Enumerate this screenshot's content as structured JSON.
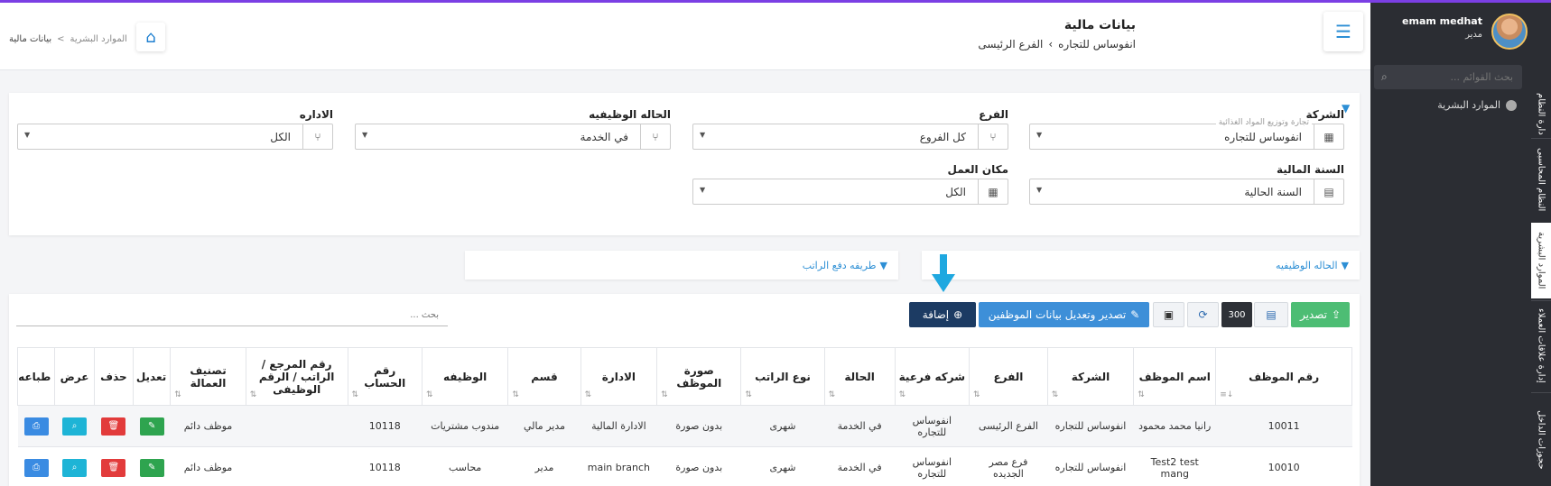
{
  "header": {
    "title": "بيانات مالية",
    "crumb_company": "انفوساس للتجاره",
    "crumb_branch": "الفرع الرئيسى",
    "left_crumb": [
      "بيانات مالية",
      "الموارد البشرية"
    ]
  },
  "user": {
    "name": "emam medhat",
    "role": "مدير"
  },
  "sidebar": {
    "search_placeholder": "بحث القوائم ...",
    "active_menu_item": "الموارد البشرية",
    "vertical_tabs": [
      "دارة النظام",
      "النظام المحاسبى",
      "الموارد البشرية",
      "إدارة علاقات العملاء",
      "حجوزات الداخل"
    ]
  },
  "filters": {
    "company": {
      "label": "الشركة",
      "hint": "تجارة وتوزيع المواد الغذائية",
      "value": "انفوساس للتجاره"
    },
    "branch": {
      "label": "الفرع",
      "value": "كل الفروع"
    },
    "job_status": {
      "label": "الحاله الوظيفيه",
      "value": "في الخدمة"
    },
    "department": {
      "label": "الاداره",
      "value": "الكل"
    },
    "fiscal_year": {
      "label": "السنة المالية",
      "value": "السنة الحالية"
    },
    "workplace": {
      "label": "مكان العمل",
      "value": "الكل"
    }
  },
  "subfilters": {
    "job_status": "الحاله الوظيفيه",
    "salary_payment": "طريقه دفع الراتب"
  },
  "toolbar": {
    "export": "تصدير",
    "page_size": "300",
    "export_edit_employees": "تصدير وتعديل بيانات الموظفين",
    "add": "إضافة",
    "search_placeholder": "بحث ..."
  },
  "table": {
    "columns": [
      "رقم الموظف",
      "اسم الموظف",
      "الشركة",
      "الفرع",
      "شركه فرعية",
      "الحالة",
      "نوع الراتب",
      "صورة الموظف",
      "الادارة",
      "قسم",
      "الوظيفه",
      "رقم الحساب",
      "رقم المرجع / الراتب / الرقم الوظيفى",
      "تصنيف العمالة",
      "تعديل",
      "حذف",
      "عرض",
      "طباعه"
    ],
    "rows": [
      [
        "10011",
        "رانيا محمد محمود",
        "انفوساس للتجاره",
        "الفرع الرئيسى",
        "انفوساس للتجاره",
        "في الخدمة",
        "شهرى",
        "بدون صورة",
        "الادارة المالية",
        "مدير مالي",
        "مندوب مشتريات",
        "10118",
        "",
        "موظف دائم"
      ],
      [
        "10010",
        "Test2 test mang",
        "انفوساس للتجاره",
        "فرع مصر الجديده",
        "انفوساس للتجاره",
        "في الخدمة",
        "شهرى",
        "بدون صورة",
        "main branch",
        "مدير",
        "محاسب",
        "10118",
        "",
        "موظف دائم"
      ]
    ]
  },
  "colors": {
    "accent": "#2d8fd5",
    "sidebar": "#2b2d33",
    "export_btn": "#4dbd74",
    "add_btn": "#1c3b63",
    "edit_btn": "#2ea44f",
    "delete_btn": "#e23b3b",
    "view_btn": "#1eb4d6",
    "print_btn": "#3a8be2"
  }
}
